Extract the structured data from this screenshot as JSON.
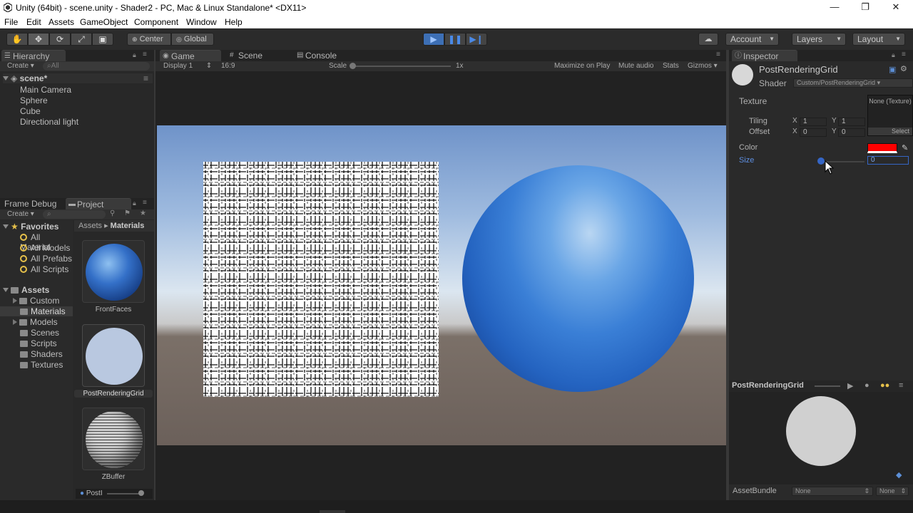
{
  "window": {
    "title": "Unity (64bit) - scene.unity - Shader2 - PC, Mac & Linux Standalone* <DX11>",
    "controls": [
      "—",
      "❐",
      "✕"
    ]
  },
  "menu": [
    "File",
    "Edit",
    "Assets",
    "GameObject",
    "Component",
    "Window",
    "Help"
  ],
  "toolbar": {
    "pivot_label": "Center",
    "space_label": "Global",
    "account_label": "Account",
    "layers_label": "Layers",
    "layout_label": "Layout"
  },
  "hierarchy": {
    "tab_label": "Hierarchy",
    "create_label": "Create",
    "search_placeholder": "All",
    "scene_name": "scene*",
    "items": [
      "Main Camera",
      "Sphere",
      "Cube",
      "Directional light"
    ]
  },
  "project": {
    "tabs": [
      "Frame Debug",
      "Project"
    ],
    "create_label": "Create",
    "favorites_label": "Favorites",
    "favorites": [
      "All Material",
      "All Models",
      "All Prefabs",
      "All Scripts"
    ],
    "assets_label": "Assets",
    "folders": [
      "Custom",
      "Materials",
      "Models",
      "Scenes",
      "Scripts",
      "Shaders",
      "Textures"
    ],
    "breadcrumb_root": "Assets",
    "breadcrumb_current": "Materials",
    "thumbnails": [
      "FrontFaces",
      "PostRenderingGrid",
      "ZBuffer"
    ],
    "bottom_field": "PostI"
  },
  "game": {
    "tabs": [
      "Game",
      "Scene",
      "Console"
    ],
    "display_label": "Display 1",
    "aspect_label": "16:9",
    "scale_label": "Scale",
    "scale_value": "1x",
    "options": [
      "Maximize on Play",
      "Mute audio",
      "Stats",
      "Gizmos"
    ]
  },
  "inspector": {
    "tab_label": "Inspector",
    "material_name": "PostRenderingGrid",
    "shader_label": "Shader",
    "shader_value": "Custom/PostRenderingGrid",
    "texture_label": "Texture",
    "texture_slot": "None (Texture)",
    "texture_select": "Select",
    "tiling_label": "Tiling",
    "offset_label": "Offset",
    "tiling_x": "1",
    "tiling_y": "1",
    "offset_x": "0",
    "offset_y": "0",
    "axis_x": "X",
    "axis_y": "Y",
    "color_label": "Color",
    "color_value": "#ff0000",
    "size_label": "Size",
    "size_value": "0",
    "preview_title": "PostRenderingGrid",
    "assetbundle_label": "AssetBundle",
    "assetbundle_name": "None",
    "assetbundle_variant": "None"
  }
}
